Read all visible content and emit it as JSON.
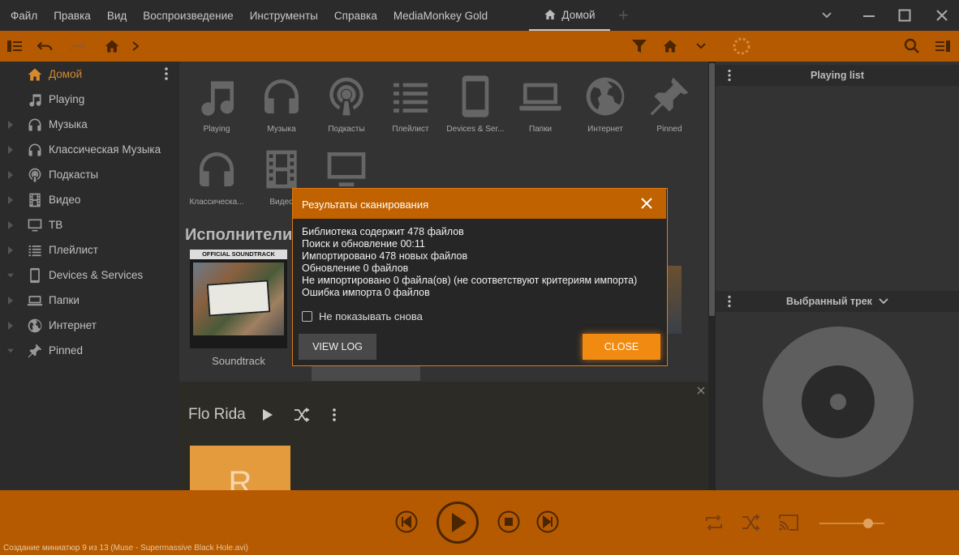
{
  "menu": {
    "items": [
      "Файл",
      "Правка",
      "Вид",
      "Воспроизведение",
      "Инструменты",
      "Справка",
      "MediaMonkey Gold"
    ],
    "home_tab": "Домой",
    "new_tab_symbol": "+"
  },
  "sidebar": {
    "items": [
      {
        "label": "Домой",
        "icon": "home-icon",
        "active": true
      },
      {
        "label": "Playing",
        "icon": "music-note-icon"
      },
      {
        "label": "Музыка",
        "icon": "headphones-icon"
      },
      {
        "label": "Классическая Музыка",
        "icon": "headphones-icon"
      },
      {
        "label": "Подкасты",
        "icon": "podcast-icon"
      },
      {
        "label": "Видео",
        "icon": "film-icon"
      },
      {
        "label": "ТВ",
        "icon": "tv-icon"
      },
      {
        "label": "Плейлист",
        "icon": "list-icon"
      },
      {
        "label": "Devices & Services",
        "icon": "phone-icon"
      },
      {
        "label": "Папки",
        "icon": "laptop-icon"
      },
      {
        "label": "Интернет",
        "icon": "globe-icon"
      },
      {
        "label": "Pinned",
        "icon": "pin-icon"
      }
    ]
  },
  "main": {
    "tiles": [
      {
        "label": "Playing",
        "icon": "music-note-icon"
      },
      {
        "label": "Музыка",
        "icon": "headphones-icon"
      },
      {
        "label": "Подкасты",
        "icon": "podcast-icon"
      },
      {
        "label": "Плейлист",
        "icon": "list-icon"
      },
      {
        "label": "Devices & Ser...",
        "icon": "phone-icon"
      },
      {
        "label": "Папки",
        "icon": "laptop-icon"
      },
      {
        "label": "Интернет",
        "icon": "globe-icon"
      },
      {
        "label": "Pinned",
        "icon": "pin-icon"
      },
      {
        "label": "Классическа...",
        "icon": "headphones-icon"
      },
      {
        "label": "Видео",
        "icon": "film-icon"
      },
      {
        "label": "",
        "icon": "tv-icon"
      }
    ],
    "section_title": "Исполнители (",
    "album_label": "Soundtrack",
    "album_cover_text": "OFFICIAL SOUNDTRACK",
    "artist_name": "Flo Rida",
    "artist_initial": "R"
  },
  "rightpanel": {
    "playing_list_title": "Playing list",
    "selected_track_title": "Выбранный трек"
  },
  "player": {
    "status": "Создание миниатюр 9 из 13 (Muse - Supermassive Black Hole.avi)",
    "volume": 0.75
  },
  "dialog": {
    "title": "Результаты сканирования",
    "lines": [
      "Библиотека содержит 478 файлов",
      "Поиск и обновление 00:11",
      "Импортировано 478 новых файлов",
      "Обновление 0 файлов",
      "Не импортировано 0 файла(ов) (не соответствуют критериям импорта)",
      "Ошибка импорта 0 файлов"
    ],
    "checkbox_label": "Не показывать снова",
    "view_log": "VIEW LOG",
    "close": "CLOSE"
  },
  "colors": {
    "accent": "#b55a00",
    "dialog_header": "#c16200",
    "close_button": "#f08a10",
    "active_item": "#d68a30"
  }
}
